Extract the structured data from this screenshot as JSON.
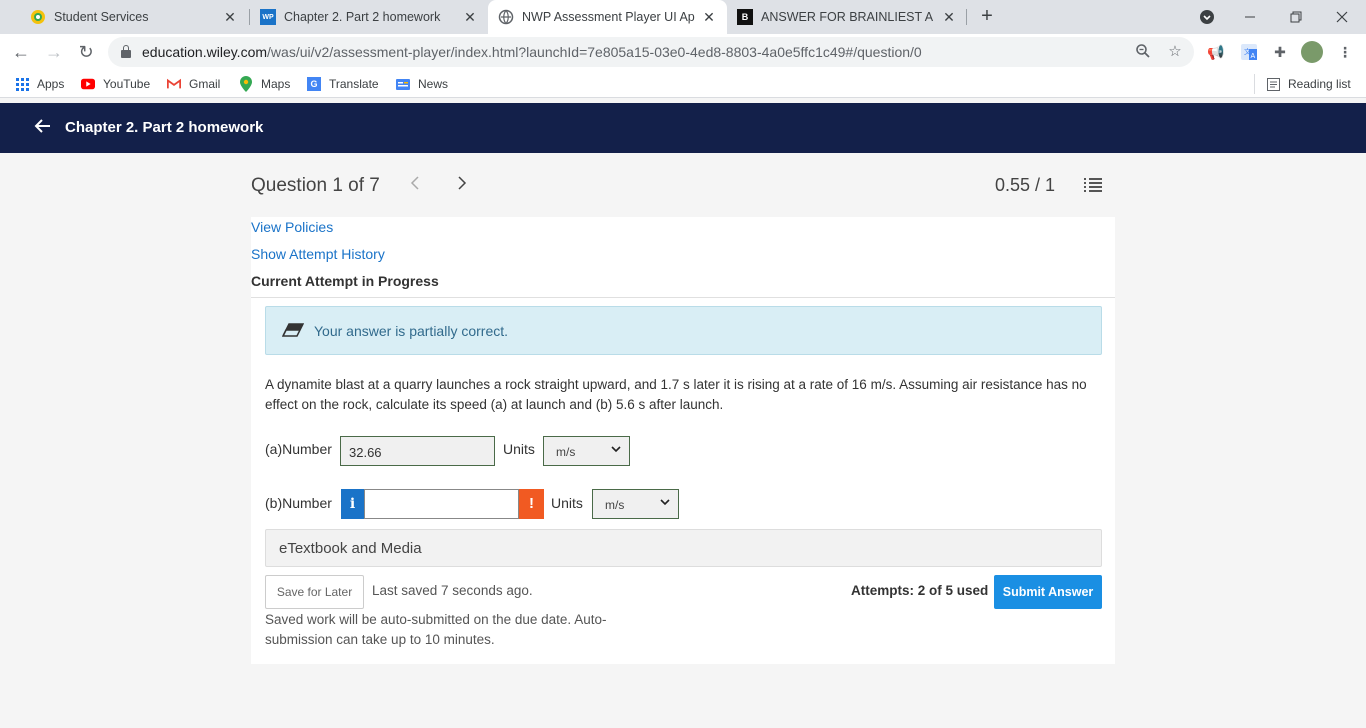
{
  "browser": {
    "tabs": [
      {
        "title": "Student Services",
        "icon": "student-services-icon",
        "active": false
      },
      {
        "title": "Chapter 2. Part 2 homework",
        "icon": "wp-icon",
        "active": false
      },
      {
        "title": "NWP Assessment Player UI Appli",
        "icon": "globe-icon",
        "active": true
      },
      {
        "title": "ANSWER FOR BRAINLIEST A bus",
        "icon": "brainly-icon",
        "active": false
      }
    ],
    "url_host": "education.wiley.com",
    "url_path": "/was/ui/v2/assessment-player/index.html?launchId=7e805a15-03e0-4ed8-8803-4a0e5ffc1c49#/question/0",
    "wp_favicon_text": "WP",
    "brainly_favicon_text": "B",
    "translate_favicon_text": "G",
    "bookmarks": [
      {
        "label": "Apps",
        "icon": "apps-grid-icon"
      },
      {
        "label": "YouTube",
        "icon": "youtube-icon"
      },
      {
        "label": "Gmail",
        "icon": "gmail-icon"
      },
      {
        "label": "Maps",
        "icon": "maps-pin-icon"
      },
      {
        "label": "Translate",
        "icon": "translate-icon"
      },
      {
        "label": "News",
        "icon": "news-icon"
      }
    ],
    "reading_list": "Reading list"
  },
  "header": {
    "title": "Chapter 2. Part 2 homework"
  },
  "question_nav": {
    "title": "Question 1 of 7",
    "score": "0.55 / 1"
  },
  "content": {
    "view_policies": "View Policies",
    "show_attempt_history": "Show Attempt History",
    "current_attempt": "Current Attempt in Progress",
    "feedback": "Your answer is partially correct.",
    "prompt": "A dynamite blast at a quarry launches a rock straight upward, and 1.7 s later it is rising at a rate of 16 m/s. Assuming air resistance has no effect on the rock, calculate its speed (a) at launch and (b) 5.6 s after launch.",
    "part_a": {
      "label": "(a)Number",
      "value": "32.66",
      "units_label": "Units",
      "units": "m/s"
    },
    "part_b": {
      "label": "(b)Number",
      "value": "",
      "units_label": "Units",
      "units": "m/s",
      "info_glyph": "i",
      "warn_glyph": "!"
    },
    "etextbook": "eTextbook and Media",
    "save_for_later": "Save for Later",
    "last_saved": "Last saved 7 seconds ago.",
    "attempts": "Attempts: 2 of 5 used",
    "submit": "Submit Answer",
    "autosubmit_note": "Saved work will be auto-submitted on the due date. Auto-submission can take up to 10 minutes."
  },
  "colors": {
    "header_bg": "#13204a",
    "link": "#1a73c8",
    "submit": "#1a8fe3",
    "alert_bg": "#d9eef5",
    "warn": "#f15a22"
  }
}
